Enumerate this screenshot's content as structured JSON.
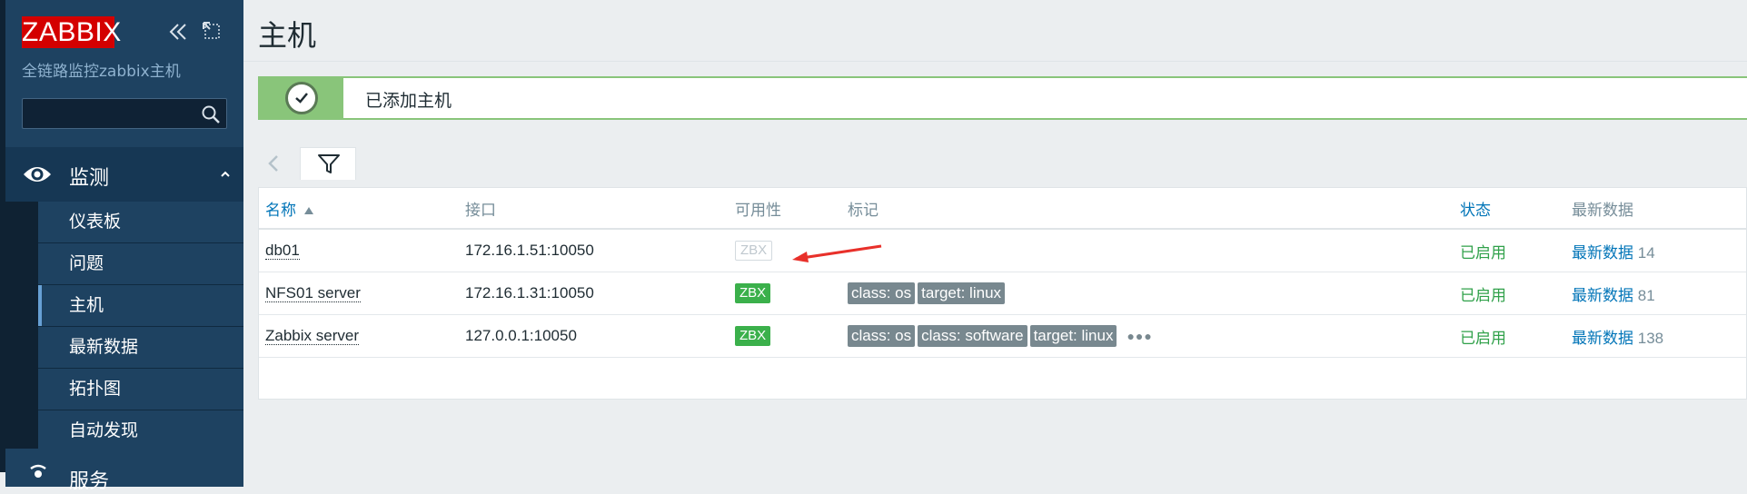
{
  "sidebar": {
    "logo": "ZABBIX",
    "subtitle": "全链路监控zabbix主机",
    "search": {
      "value": "",
      "placeholder": ""
    },
    "monitor_label": "监测",
    "items": [
      {
        "label": "仪表板",
        "selected": false
      },
      {
        "label": "问题",
        "selected": false
      },
      {
        "label": "主机",
        "selected": true
      },
      {
        "label": "最新数据",
        "selected": false
      },
      {
        "label": "拓扑图",
        "selected": false
      },
      {
        "label": "自动发现",
        "selected": false
      }
    ],
    "services_label": "服务"
  },
  "page": {
    "title": "主机",
    "message": "已添加主机"
  },
  "table": {
    "headers": {
      "name": "名称",
      "interface": "接口",
      "availability": "可用性",
      "tags": "标记",
      "status": "状态",
      "latest": "最新数据"
    },
    "rows": [
      {
        "name": "db01",
        "interface": "172.16.1.51:10050",
        "availability": "ZBX",
        "availability_state": "unknown",
        "tags": [],
        "status": "已启用",
        "latest_label": "最新数据",
        "latest_count": "14"
      },
      {
        "name": "NFS01 server",
        "interface": "172.16.1.31:10050",
        "availability": "ZBX",
        "availability_state": "available",
        "tags": [
          "class: os",
          "target: linux"
        ],
        "status": "已启用",
        "latest_label": "最新数据",
        "latest_count": "81"
      },
      {
        "name": "Zabbix server",
        "interface": "127.0.0.1:10050",
        "availability": "ZBX",
        "availability_state": "available",
        "tags": [
          "class: os",
          "class: software",
          "target: linux"
        ],
        "status": "已启用",
        "latest_label": "最新数据",
        "latest_count": "138"
      }
    ]
  },
  "colors": {
    "sidebar": "#1e4261",
    "logo_red": "#d40000",
    "success_green": "#89c57a",
    "zbx_green": "#3bb04b",
    "link_blue": "#0275b8",
    "annotation_red": "#e8302a"
  }
}
